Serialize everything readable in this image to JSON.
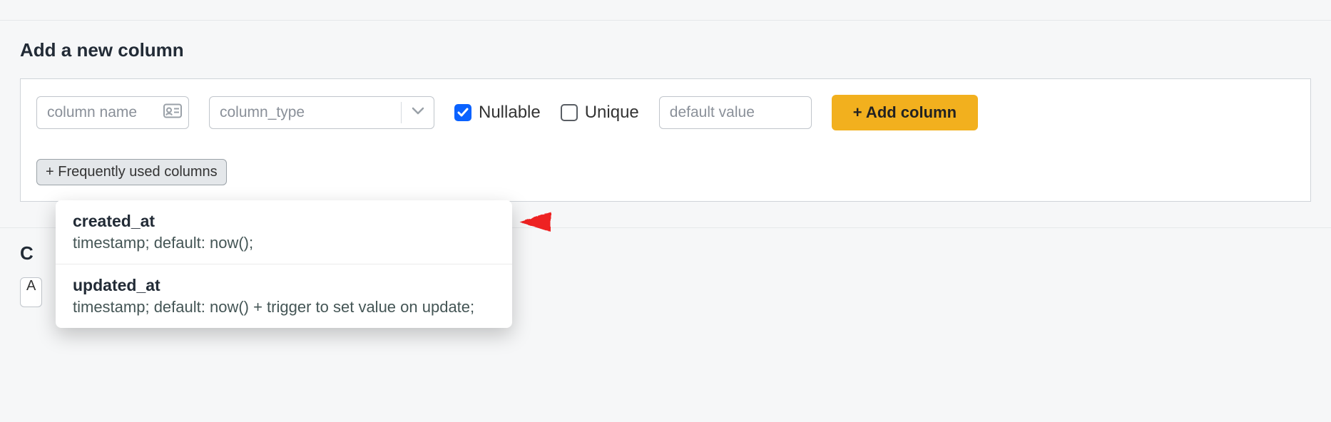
{
  "section_title": "Add a new column",
  "inputs": {
    "column_name": {
      "placeholder": "column name",
      "value": ""
    },
    "column_type": {
      "placeholder": "column_type",
      "value": ""
    },
    "default_value": {
      "placeholder": "default value",
      "value": ""
    }
  },
  "checkboxes": {
    "nullable": {
      "label": "Nullable",
      "checked": true
    },
    "unique": {
      "label": "Unique",
      "checked": false
    }
  },
  "buttons": {
    "add_column": "+ Add column",
    "frequently_used": "+ Frequently used columns"
  },
  "dropdown_items": [
    {
      "name": "created_at",
      "desc": "timestamp; default: now();"
    },
    {
      "name": "updated_at",
      "desc": "timestamp; default: now() + trigger to set value on update;"
    }
  ],
  "peek_section_prefix": "C",
  "peek_field_char": "A",
  "colors": {
    "primary_button": "#f2b01e",
    "checkbox_checked": "#0a62ff"
  }
}
